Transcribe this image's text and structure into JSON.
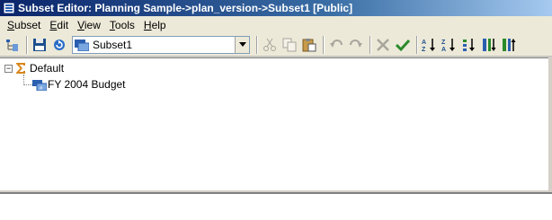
{
  "window": {
    "title": "Subset Editor:  Planning Sample->plan_version->Subset1  [Public]",
    "app_icon": "subset-editor-icon"
  },
  "menu": [
    {
      "label": "Subset",
      "accel": "S",
      "rest": "ubset"
    },
    {
      "label": "Edit",
      "accel": "E",
      "rest": "dit"
    },
    {
      "label": "View",
      "accel": "V",
      "rest": "iew"
    },
    {
      "label": "Tools",
      "accel": "T",
      "rest": "ools"
    },
    {
      "label": "Help",
      "accel": "H",
      "rest": "elp"
    }
  ],
  "toolbar": {
    "subset_combo": {
      "selected": "Subset1",
      "icon": "subset-icon"
    },
    "buttons": [
      "tree-view-icon",
      "save-icon",
      "refresh-icon",
      "cut-icon",
      "copy-icon",
      "paste-icon",
      "undo-icon",
      "redo-icon",
      "delete-icon",
      "keep-icon",
      "sort-asc-icon",
      "sort-desc-icon",
      "sort-hier-icon",
      "expand-icon",
      "collapse-icon"
    ]
  },
  "tree": {
    "root": {
      "label": "Default",
      "icon": "sigma-consolidation-icon",
      "expanded": true
    },
    "children": [
      {
        "label": "FY 2004 Budget",
        "icon": "leaf-element-icon"
      }
    ]
  },
  "colors": {
    "title_start": "#0a246a",
    "title_end": "#a6caf0",
    "accent": "#d8861a"
  }
}
